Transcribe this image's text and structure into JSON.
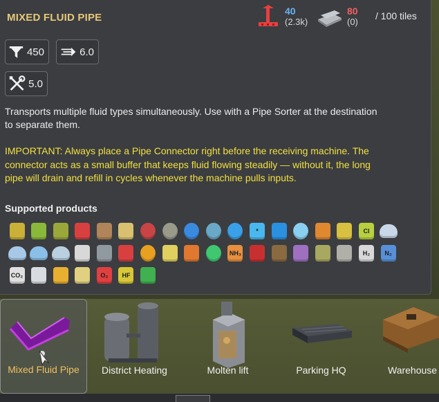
{
  "tooltip": {
    "title": "MIXED FLUID PIPE",
    "cost_workers": {
      "value": "40",
      "sub": "(2.3k)",
      "color": "#6ab0f0",
      "icon": "crane-icon"
    },
    "cost_material": {
      "value": "80",
      "sub": "(0)",
      "color": "#f06060",
      "icon": "steel-plate-icon"
    },
    "tiles": "/ 100 tiles",
    "stats": [
      {
        "icon": "filter-icon",
        "value": "450"
      },
      {
        "icon": "flow-icon",
        "value": "6.0"
      },
      {
        "icon": "maintenance-icon",
        "value": "5.0"
      }
    ],
    "description": "Transports multiple fluid types simultaneously. Use with a Pipe Sorter at the destination to separate them.",
    "important": "IMPORTANT: Always place a Pipe Connector right before the receiving machine. The connector acts as a small buffer that keeps fluid flowing steadily — without it, the long pipe will drain and refill in cycles whenever the machine pulls inputs.",
    "supported_label": "Supported products",
    "products": [
      {
        "name": "fuel-can-yellow-icon",
        "c": "#c9b037",
        "t": ""
      },
      {
        "name": "fuel-can-green-icon",
        "c": "#8ab83a",
        "t": ""
      },
      {
        "name": "fuel-can-olive-icon",
        "c": "#9aa83a",
        "t": ""
      },
      {
        "name": "red-pipe-icon",
        "c": "#d84040",
        "t": ""
      },
      {
        "name": "glass-bottle-icon",
        "c": "#b0855a",
        "t": ""
      },
      {
        "name": "beaker-icon",
        "c": "#d8c070",
        "t": ""
      },
      {
        "name": "red-disc-icon",
        "c": "#c94545",
        "t": ""
      },
      {
        "name": "grey-disc-icon",
        "c": "#9a9a8a",
        "t": ""
      },
      {
        "name": "blue-disc-icon",
        "c": "#3a8ae0",
        "t": ""
      },
      {
        "name": "teal-disc-icon",
        "c": "#6aa8c8",
        "t": ""
      },
      {
        "name": "water-drop-icon",
        "c": "#3aa0e8",
        "t": ""
      },
      {
        "name": "snowflake-icon",
        "c": "#4ab8f0",
        "t": "*"
      },
      {
        "name": "wave-icon",
        "c": "#2a90e0",
        "t": ""
      },
      {
        "name": "pale-drop-icon",
        "c": "#8ad0f0",
        "t": ""
      },
      {
        "name": "orange-pipe-icon",
        "c": "#e08830",
        "t": ""
      },
      {
        "name": "yellow-pipe-icon",
        "c": "#d8c040",
        "t": ""
      },
      {
        "name": "chlorine-tank-icon",
        "c": "#b8d040",
        "t": "Cl"
      },
      {
        "name": "rain-cloud-icon",
        "c": "#c8d8e8",
        "t": ""
      },
      {
        "name": "storm-cloud-icon",
        "c": "#a8c8e8",
        "t": ""
      },
      {
        "name": "steam-cloud-icon",
        "c": "#8ac0e8",
        "t": ""
      },
      {
        "name": "cloud-icon",
        "c": "#b8d0e0",
        "t": ""
      },
      {
        "name": "tree-icon",
        "c": "#d8d8d8",
        "t": ""
      },
      {
        "name": "metal-pipe-icon",
        "c": "#9098a0",
        "t": ""
      },
      {
        "name": "red-canister-icon",
        "c": "#d84040",
        "t": ""
      },
      {
        "name": "oil-drop-icon",
        "c": "#e8a020",
        "t": ""
      },
      {
        "name": "yellow-beaker-icon",
        "c": "#e0d060",
        "t": ""
      },
      {
        "name": "flame-tank-icon",
        "c": "#e07830",
        "t": ""
      },
      {
        "name": "green-drop-icon",
        "c": "#40c870",
        "t": ""
      },
      {
        "name": "ammonia-tank-icon",
        "c": "#e89040",
        "t": "NH₃"
      },
      {
        "name": "red-flask-icon",
        "c": "#c83030",
        "t": ""
      },
      {
        "name": "brown-beaker-icon",
        "c": "#8a6a40",
        "t": ""
      },
      {
        "name": "purple-beaker-icon",
        "c": "#a070c0",
        "t": ""
      },
      {
        "name": "olive-beaker-icon",
        "c": "#a8a860",
        "t": ""
      },
      {
        "name": "grey-beaker-icon",
        "c": "#b0b0a8",
        "t": ""
      },
      {
        "name": "hydrogen-tank-icon",
        "c": "#d8d8d8",
        "t": "H₂"
      },
      {
        "name": "nitrogen-tank-icon",
        "c": "#5890d8",
        "t": "N₂"
      },
      {
        "name": "co2-tank-icon",
        "c": "#e0e0e0",
        "t": "CO₂"
      },
      {
        "name": "white-beaker-icon",
        "c": "#d8dce0",
        "t": ""
      },
      {
        "name": "yellow-bottle-icon",
        "c": "#e8b030",
        "t": ""
      },
      {
        "name": "cream-beaker-icon",
        "c": "#e0d080",
        "t": ""
      },
      {
        "name": "oxygen-tank-icon",
        "c": "#e04040",
        "t": "O₂"
      },
      {
        "name": "hf-canister-icon",
        "c": "#d8c838",
        "t": "HF"
      },
      {
        "name": "acid-canister-icon",
        "c": "#40b050",
        "t": ""
      }
    ]
  },
  "buildbar": {
    "items": [
      {
        "label": "Mixed Fluid Pipe",
        "selected": true
      },
      {
        "label": "District Heating",
        "selected": false
      },
      {
        "label": "Molten lift",
        "selected": false
      },
      {
        "label": "Parking HQ",
        "selected": false
      },
      {
        "label": "Warehouse",
        "selected": false
      }
    ]
  }
}
